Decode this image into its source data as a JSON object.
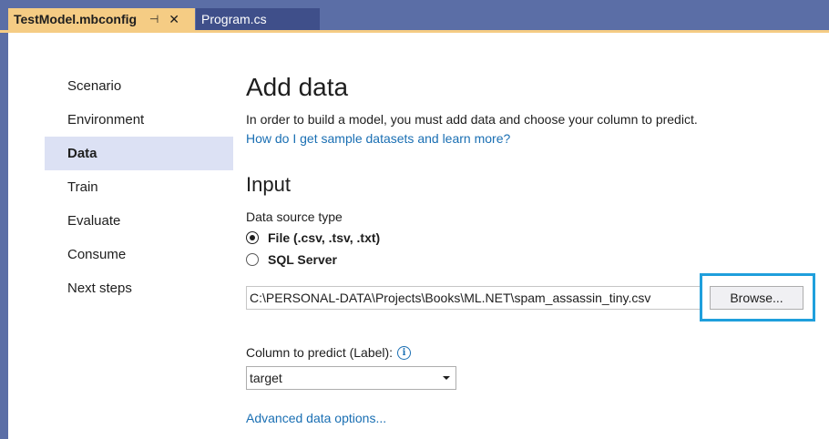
{
  "tabs": {
    "active": {
      "title": "TestModel.mbconfig",
      "pin_glyph": "⊣",
      "close_glyph": "✕"
    },
    "inactive": {
      "title": "Program.cs"
    }
  },
  "nav": {
    "items": [
      {
        "label": "Scenario"
      },
      {
        "label": "Environment"
      },
      {
        "label": "Data",
        "selected": true
      },
      {
        "label": "Train"
      },
      {
        "label": "Evaluate"
      },
      {
        "label": "Consume"
      },
      {
        "label": "Next steps"
      }
    ]
  },
  "main": {
    "title": "Add data",
    "intro": "In order to build a model, you must add data and choose your column to predict.",
    "sample_link": "How do I get sample datasets and learn more?",
    "input_section": {
      "title": "Input",
      "source_type_label": "Data source type",
      "options": [
        {
          "label": "File (.csv, .tsv, .txt)",
          "checked": true
        },
        {
          "label": "SQL Server",
          "checked": false
        }
      ],
      "file_path": "C:\\PERSONAL-DATA\\Projects\\Books\\ML.NET\\spam_assassin_tiny.csv",
      "browse_label": "Browse...",
      "column_label": "Column to predict (Label):",
      "info_glyph": "i",
      "column_value": "target",
      "advanced_link": "Advanced data options..."
    }
  },
  "colors": {
    "tab_strip": "#5b6ea6",
    "active_tab": "#f5cc84",
    "selected_nav": "#dce1f4",
    "link": "#1a6fb3",
    "highlight": "#1f9fdc"
  }
}
